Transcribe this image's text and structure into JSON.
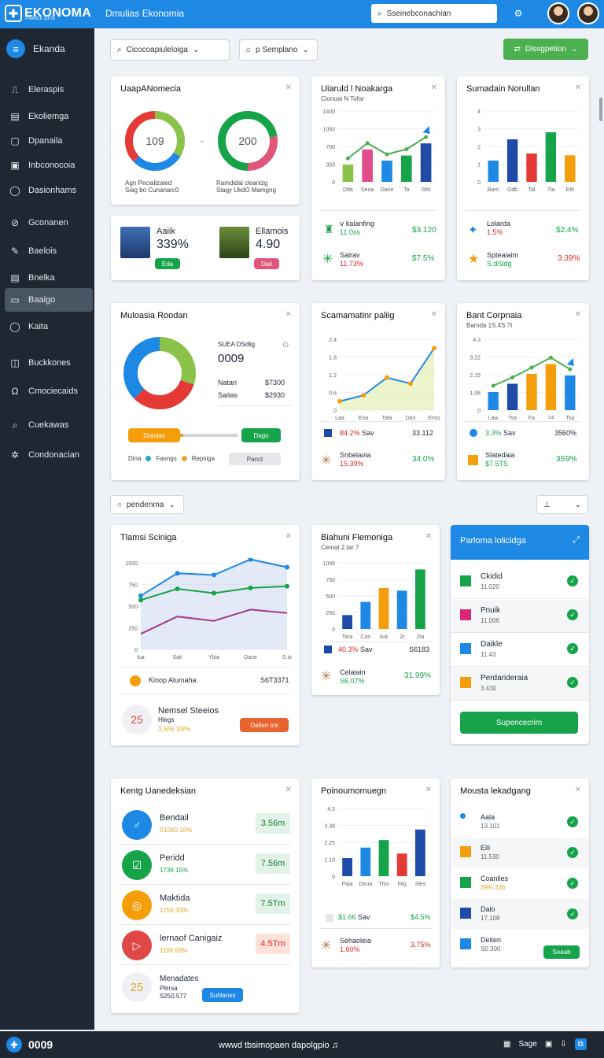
{
  "header": {
    "logo": "EKONOMA",
    "logo_sub": "FINANCE SUITE",
    "app_title": "Dmulias Ekonomia",
    "search_placeholder": "Sseinebconachian"
  },
  "sidebar": {
    "header": "Ekanda",
    "items": [
      {
        "label": "Eleraspis",
        "icon": "bell-icon",
        "glyph": "⎍"
      },
      {
        "label": "Ekoliemga",
        "icon": "briefcase-icon",
        "glyph": "▤"
      },
      {
        "label": "Dpanaila",
        "icon": "folder-icon",
        "glyph": "▢"
      },
      {
        "label": "Inbconocoia",
        "icon": "calendar-icon",
        "glyph": "▣"
      },
      {
        "label": "Dasionhams",
        "icon": "circle-icon",
        "glyph": "◯"
      },
      {
        "label": "Gconanen",
        "icon": "link-icon",
        "glyph": "⊘"
      },
      {
        "label": "Baelois",
        "icon": "wrench-icon",
        "glyph": "✎"
      },
      {
        "label": "Bnelka",
        "icon": "bag-icon",
        "glyph": "▤"
      },
      {
        "label": "Baaigo",
        "icon": "window-icon",
        "glyph": "▭"
      },
      {
        "label": "Kaita",
        "icon": "circle-icon",
        "glyph": "◯"
      },
      {
        "label": "Buckkones",
        "icon": "box-icon",
        "glyph": "◫"
      },
      {
        "label": "Cmociecaids",
        "icon": "chat-icon",
        "glyph": "Ω"
      },
      {
        "label": "Cuekawas",
        "icon": "search-icon",
        "glyph": "⌕"
      },
      {
        "label": "Condonacian",
        "icon": "gear-icon",
        "glyph": "✲"
      }
    ]
  },
  "toolbar": {
    "filter_label": "Cicocoapiuleloiga",
    "sample_label": "p Semplano",
    "green_btn": "Dissgpetion",
    "mid_filter": "pendenma"
  },
  "cards": {
    "c1": {
      "title": "UaapANomecia",
      "d1": "109",
      "d2": "200",
      "l1a": "Agn Pecializaied",
      "l1b": "Siag bo Cunanarc0",
      "l2a": "Ramdidal cleanizg",
      "l2b": "Siagy UkdO Mamgng"
    },
    "c2": {
      "name1": "Aaiik",
      "val1": "339%",
      "btn1": "Eda",
      "name2": "Ellamois",
      "val2": "4.90",
      "btn2": "Daii"
    },
    "c3": {
      "title": "Uiaruld l Noakarga",
      "sub": "Cionuai N Tofar",
      "r1a": "ⅴ kalanfing",
      "r1b": "11.0ss",
      "r1v": "$3.120",
      "r2a": "Salrav",
      "r2b": "11.73%",
      "r2v": "$7.5%"
    },
    "c4": {
      "title": "Sumadain Norullan",
      "r1a": "Lolarda",
      "r1b": "1.5%",
      "r1v": "$2.4%",
      "r2a": "Spteaiaim",
      "r2b": "S.dSldg",
      "r2v": "3.39%"
    },
    "c5": {
      "title": "Muloasia Roodan",
      "k_label": "SUEA DSdlig",
      "k_val": "0009",
      "r1a": "Natan",
      "r1v": "$7300",
      "r2a": "Saitas",
      "r2v": "$2930",
      "btn1": "Dranias",
      "btn2": "Dago",
      "l1": "Dina",
      "l2": "Fasngs",
      "l3": "Repsiga",
      "l4": "Panct"
    },
    "c6": {
      "title": "Scamamatinr paliig",
      "r1a": "84.2%",
      "r1b": "Sav",
      "r1v": "33.112",
      "r2a": "Snbelavia",
      "r2b": "15.39%",
      "r2v": "34.0%"
    },
    "c7": {
      "title": "Bant Corpnaia",
      "sub": "Bamda 1S.4S ?I",
      "r1a": "3.3%",
      "r1b": "Sav",
      "r1v": "3560%",
      "r2a": "Slatedaia",
      "r2b": "$7.5TS",
      "r2v": "3S9%"
    },
    "c8": {
      "title": "Tlamsi Scinigа",
      "r1a": "Kinop Alumaha",
      "r1v": "S6T3371",
      "k_val": "25",
      "k_title": "Nemsel Steeios",
      "k_sub": "Hlegs",
      "k_pct": "3.6% 39%",
      "k_btn": "Oallen ice"
    },
    "c9": {
      "title": "Biahuni Flemoniga",
      "sub": "Cemat 2.tar 7",
      "r1a": "40.3%",
      "r1b": "Sav",
      "r1v": "S6183",
      "r2a": "Celaiain",
      "r2b": "S6.07%",
      "r2v": "31.99%"
    },
    "c10": {
      "title": "Parloma lolicidga",
      "items": [
        {
          "a": "Ckidid",
          "b": "11.020",
          "c": "#16a34a"
        },
        {
          "a": "Pnuik",
          "b": "11.008",
          "c": "#db2777"
        },
        {
          "a": "Daikle",
          "b": "11.43",
          "c": "#1e88e5"
        },
        {
          "a": "Perdarideraia",
          "b": "3.430",
          "c": "#f59e0b"
        }
      ],
      "btn": "Supencecrim"
    },
    "c11": {
      "title": "Kentg Uanedeksian",
      "items": [
        {
          "a": "Bendail",
          "b": "S1060 16%",
          "v": "3.56m",
          "c": "#1e88e5",
          "g": "♂"
        },
        {
          "a": "Peridd",
          "b": "1736 15%",
          "v": "7.56m",
          "c": "#16a34a",
          "g": "☑"
        },
        {
          "a": "Maktida",
          "b": "1756 33%",
          "v": "7.5Tm",
          "c": "#f59e0b",
          "g": "◎"
        },
        {
          "a": "lernaof Canigaiz",
          "b": "1166 56%",
          "v": "4.5Tm",
          "c": "#e04848",
          "g": "▷"
        }
      ],
      "k_val": "25",
      "k_title": "Menadates",
      "k_sub": "Plirrsa",
      "k_num": "S250.577",
      "k_btn": "Suhlanss"
    },
    "c12": {
      "title": "Poinoumomuegn",
      "r1a": "$1.66",
      "r1b": "Sav",
      "r1v": "$4.5%",
      "r2a": "Sehaoleia",
      "r2b": "1.60%",
      "r2v": "3.75%"
    },
    "c13": {
      "title": "Mousta lekadgang",
      "items": [
        {
          "a": "Aala",
          "b": "13.101",
          "c": "#1e88e5"
        },
        {
          "a": "Elli",
          "b": "11.530",
          "c": "#f59e0b"
        },
        {
          "a": "Coanlles",
          "b": "39% 336",
          "c": "#16a34a"
        },
        {
          "a": "Dalo",
          "b": "17.108",
          "c": "#1e4aa8"
        },
        {
          "a": "Deiten",
          "b": "S0.300",
          "c": "#1e88e5"
        }
      ],
      "btn": "Seaab"
    }
  },
  "chart_data": [
    {
      "type": "pie",
      "title": "UaapANomecia",
      "values": [
        109,
        200
      ]
    },
    {
      "type": "bar",
      "title": "Uiaruld l Noakarga",
      "categories": [
        "Dda",
        "Seoa",
        "Dane",
        "Ta",
        "Stts"
      ],
      "values": [
        340,
        640,
        420,
        520,
        760
      ],
      "ylim": [
        0,
        1400
      ]
    },
    {
      "type": "bar",
      "title": "Sumadain Norullan",
      "categories": [
        "Barn",
        "Gdb",
        "Tal",
        "7ta",
        "Eth"
      ],
      "values": [
        1.2,
        2.4,
        1.6,
        2.8,
        1.5
      ],
      "ylim": [
        0,
        4
      ]
    },
    {
      "type": "line",
      "title": "Scamamatinr paliig",
      "categories": [
        "Laa",
        "Ena",
        "Tala",
        "Dan",
        "Enss"
      ],
      "values": [
        0.3,
        0.5,
        1.1,
        0.9,
        2.1
      ],
      "ylim": [
        0,
        2.4
      ]
    },
    {
      "type": "bar",
      "title": "Bant Corpnaia",
      "categories": [
        "Law",
        "Tsa",
        "Fa",
        "74",
        "Tsa"
      ],
      "values": [
        1.1,
        1.6,
        2.2,
        2.8,
        2.1
      ],
      "ylim": [
        0,
        4.3
      ]
    },
    {
      "type": "line",
      "title": "Tlamsi Scinigа",
      "categories": [
        "lua",
        "Sak",
        "Ybia",
        "Dane",
        "S.ts"
      ],
      "values": [
        620,
        880,
        860,
        1040,
        950
      ],
      "ylim": [
        0,
        1000
      ]
    },
    {
      "type": "bar",
      "title": "Biahuni Flemoniga",
      "categories": [
        "Tara",
        "Can",
        "3uk",
        "2t",
        "2ta"
      ],
      "values": [
        210,
        410,
        620,
        580,
        900
      ],
      "ylim": [
        0,
        1000
      ]
    },
    {
      "type": "bar",
      "title": "Poinoumomuegn",
      "categories": [
        "Paia",
        "Deua",
        "This",
        "Ihlg",
        "Sles"
      ],
      "values": [
        1.2,
        1.9,
        2.4,
        1.5,
        3.1
      ],
      "ylim": [
        0,
        4.5
      ]
    }
  ]
}
